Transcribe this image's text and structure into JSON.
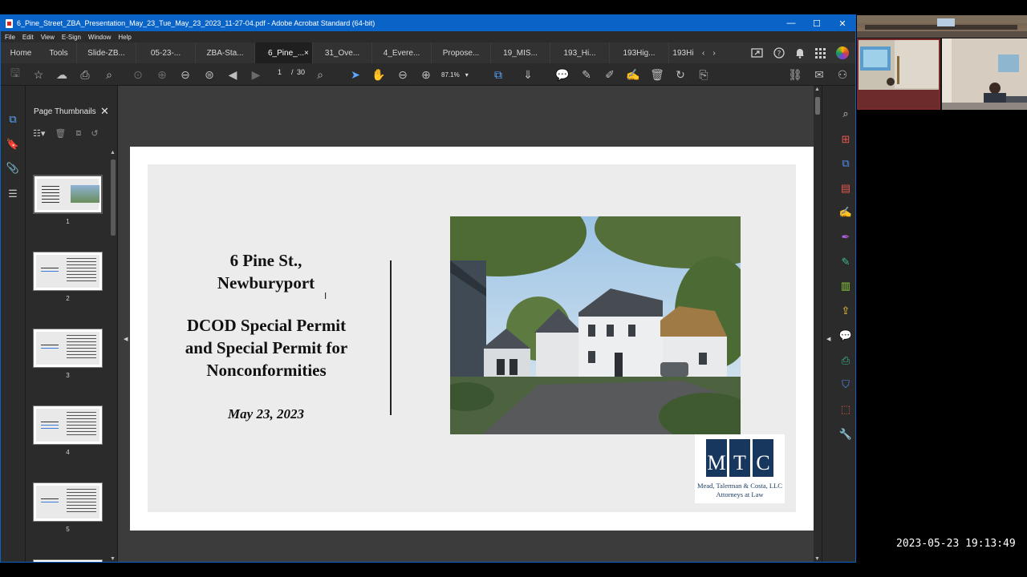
{
  "window": {
    "title": "6_Pine_Street_ZBA_Presentation_May_23_Tue_May_23_2023_11-27-04.pdf - Adobe Acrobat Standard (64-bit)",
    "controls": [
      "—",
      "☐",
      "✕"
    ]
  },
  "menu": [
    "File",
    "Edit",
    "View",
    "E-Sign",
    "Window",
    "Help"
  ],
  "tabs": {
    "home": "Home",
    "tools": "Tools",
    "documents": [
      "Slide-ZB...",
      "05-23-...",
      "ZBA-Sta...",
      "6_Pine_...",
      "31_Ove...",
      "4_Evere...",
      "Propose...",
      "19_MIS...",
      "193_Hi...",
      "193Hig...",
      "193Hi"
    ],
    "active_index": 3,
    "active_close": "×"
  },
  "toolbar": {
    "current_page": "1",
    "page_separator": "/",
    "total_pages": "30",
    "zoom": "87.1%"
  },
  "thumbnails_panel": {
    "title": "Page Thumbnails",
    "close": "✕",
    "page_numbers": [
      "1",
      "2",
      "3",
      "4",
      "5"
    ]
  },
  "slide": {
    "title_line1": "6 Pine St.,",
    "title_line2": "Newburyport",
    "subtitle_line1": "DCOD Special Permit",
    "subtitle_line2": "and Special Permit for",
    "subtitle_line3": "Nonconformities",
    "date": "May 23, 2023",
    "logo": {
      "letters": [
        "M",
        "T",
        "C"
      ],
      "firm_line1": "Mead, Talerman & Costa, LLC",
      "firm_line2": "Attorneys at Law",
      "color": "#17375e"
    }
  },
  "overlay": {
    "timestamp": "2023-05-23 19:13:49"
  },
  "colors": {
    "titlebar": "#0a64c8",
    "app_bg": "#2b2b2b",
    "doc_bg": "#3c3c3c",
    "slide_bg": "#ececec"
  }
}
